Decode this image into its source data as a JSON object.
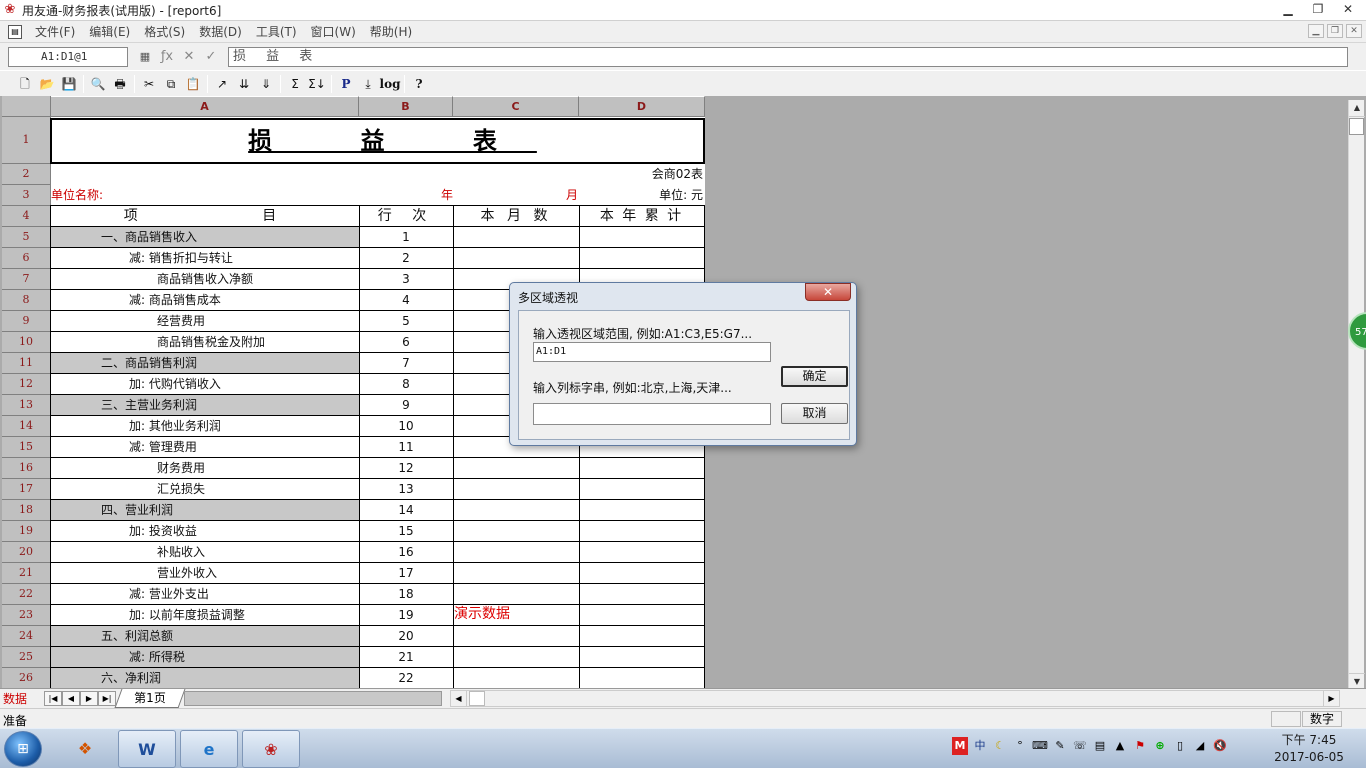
{
  "window": {
    "title": "用友通-财务报表(试用版) - [report6]",
    "min_glyph": "▁",
    "max_glyph": "❐",
    "close_glyph": "✕",
    "icon": "app-logo-icon"
  },
  "menu": {
    "items": [
      "文件(F)",
      "编辑(E)",
      "格式(S)",
      "数据(D)",
      "工具(T)",
      "窗口(W)",
      "帮助(H)"
    ]
  },
  "formula_bar": {
    "cell_ref": "A1:D1@1",
    "formula": "损 益 表"
  },
  "toolbar": {
    "icons": [
      "new-icon",
      "open-icon",
      "save-icon",
      "print-preview-icon",
      "print-icon",
      "cut-icon",
      "copy-icon",
      "paste-icon",
      "chart-icon",
      "sort-asc-icon",
      "sort-desc-icon",
      "sum-icon",
      "sum-all-icon",
      "p-icon",
      "insert-icon",
      "log-icon",
      "help-icon"
    ],
    "labels": [
      "P",
      "log"
    ]
  },
  "sheet": {
    "columns": [
      "A",
      "B",
      "C",
      "D"
    ],
    "title": "损 益 表",
    "row2_right": "会商02表",
    "row3": {
      "unit_name": "单位名称:",
      "year": "年",
      "month": "月",
      "unit": "单位: 元"
    },
    "header": {
      "item": "项 目",
      "line_no": "行 次",
      "this_month": "本 月 数",
      "this_year": "本 年 累 计"
    },
    "rows": [
      {
        "num": "5",
        "item": "一、商品销售收入",
        "line": "1",
        "shade": true,
        "indent": 0
      },
      {
        "num": "6",
        "item": "减: 销售折扣与转让",
        "line": "2",
        "shade": false,
        "indent": 1
      },
      {
        "num": "7",
        "item": "商品销售收入净额",
        "line": "3",
        "shade": false,
        "indent": 2
      },
      {
        "num": "8",
        "item": "减: 商品销售成本",
        "line": "4",
        "shade": false,
        "indent": 1
      },
      {
        "num": "9",
        "item": "经营费用",
        "line": "5",
        "shade": false,
        "indent": 2
      },
      {
        "num": "10",
        "item": "商品销售税金及附加",
        "line": "6",
        "shade": false,
        "indent": 2
      },
      {
        "num": "11",
        "item": "二、商品销售利润",
        "line": "7",
        "shade": true,
        "indent": 0
      },
      {
        "num": "12",
        "item": "加: 代购代销收入",
        "line": "8",
        "shade": false,
        "indent": 1
      },
      {
        "num": "13",
        "item": "三、主营业务利润",
        "line": "9",
        "shade": true,
        "indent": 0
      },
      {
        "num": "14",
        "item": "加: 其他业务利润",
        "line": "10",
        "shade": false,
        "indent": 1
      },
      {
        "num": "15",
        "item": "减: 管理费用",
        "line": "11",
        "shade": false,
        "indent": 1
      },
      {
        "num": "16",
        "item": "财务费用",
        "line": "12",
        "shade": false,
        "indent": 2
      },
      {
        "num": "17",
        "item": "汇兑损失",
        "line": "13",
        "shade": false,
        "indent": 2
      },
      {
        "num": "18",
        "item": "四、营业利润",
        "line": "14",
        "shade": true,
        "indent": 0
      },
      {
        "num": "19",
        "item": "加: 投资收益",
        "line": "15",
        "shade": false,
        "indent": 1
      },
      {
        "num": "20",
        "item": "补贴收入",
        "line": "16",
        "shade": false,
        "indent": 2
      },
      {
        "num": "21",
        "item": "营业外收入",
        "line": "17",
        "shade": false,
        "indent": 2
      },
      {
        "num": "22",
        "item": "减: 营业外支出",
        "line": "18",
        "shade": false,
        "indent": 1
      },
      {
        "num": "23",
        "item": "加: 以前年度损益调整",
        "line": "19",
        "shade": false,
        "indent": 1
      },
      {
        "num": "24",
        "item": "五、利润总额",
        "line": "20",
        "shade": true,
        "indent": 0
      },
      {
        "num": "25",
        "item": "减: 所得税",
        "line": "21",
        "shade": true,
        "indent": 1
      },
      {
        "num": "26",
        "item": "六、净利润",
        "line": "22",
        "shade": true,
        "indent": 0
      }
    ],
    "watermark": "演示数据"
  },
  "tabs": {
    "data_label": "数据",
    "sheet_tab": "第1页"
  },
  "status": {
    "ready": "准备",
    "numlock": "数字"
  },
  "dialog": {
    "title": "多区域透视",
    "close": "✕",
    "range_label": "输入透视区域范围, 例如:A1:C3,E5:G7...",
    "range_value": "A1:D1",
    "col_label": "输入列标字串, 例如:北京,上海,天津...",
    "col_value": "",
    "ok": "确定",
    "cancel": "取消"
  },
  "side_badge": "57",
  "taskbar": {
    "time": "下午 7:45",
    "date": "2017-06-05",
    "tray_icons": [
      "m-icon",
      "ime-icon",
      "moon-icon",
      "network-icon",
      "keyboard-icon",
      "paint-icon",
      "speech-icon",
      "notes-icon",
      "chevron-up-icon",
      "flag-icon",
      "add-icon",
      "battery-icon",
      "signal-icon",
      "volume-icon"
    ],
    "apps": [
      "start-orb-icon",
      "windows-logo-icon",
      "word-icon",
      "ie-icon",
      "ufida-icon"
    ]
  },
  "colors": {
    "accent_red": "#c00000",
    "header_maroon": "#8b1a1a",
    "shade": "#c8c8c8"
  }
}
